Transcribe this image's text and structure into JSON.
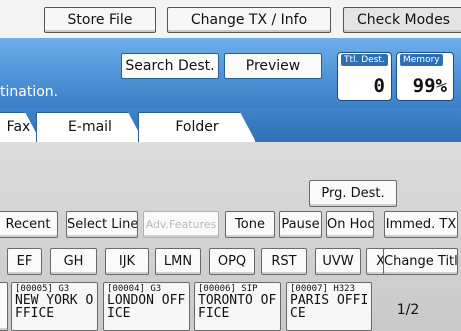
{
  "toolbar": {
    "store_file": "Store File",
    "change_tx_info": "Change TX / Info",
    "check_modes": "Check Modes"
  },
  "header": {
    "search_dest": "Search Dest.",
    "preview": "Preview",
    "hint": "tination.",
    "total_dest": {
      "label": "Ttl. Dest.",
      "value": "0"
    },
    "memory": {
      "label": "Memory",
      "value": "99%"
    }
  },
  "tabs": [
    {
      "label": "Fax"
    },
    {
      "label": "E-mail"
    },
    {
      "label": "Folder"
    }
  ],
  "actions": {
    "prg_dest": "Prg. Dest.",
    "recent": "Recent",
    "select_line": "Select Line",
    "adv_features": "Adv.Features",
    "tone": "Tone",
    "pause": "Pause",
    "on_hook": "On Hook",
    "immed_tx": "Immed. TX",
    "change_title": "Change Title"
  },
  "title_keys": [
    "EF",
    "GH",
    "IJK",
    "LMN",
    "OPQ",
    "RST",
    "UVW",
    "XYZ"
  ],
  "destinations": [
    {
      "code": "[00005] G3",
      "name": "NEW YORK O\nFFICE"
    },
    {
      "code": "[00004] G3",
      "name": "LONDON OFF\nICE"
    },
    {
      "code": "[00006] SIP",
      "name": "TORONTO OF\nFICE"
    },
    {
      "code": "[00007] H323",
      "name": "PARIS OFFI\nCE"
    }
  ],
  "pager": {
    "text": "1/2"
  },
  "colors": {
    "header_blue": "#4e93d6",
    "panel_gray": "#d4d4d4"
  }
}
